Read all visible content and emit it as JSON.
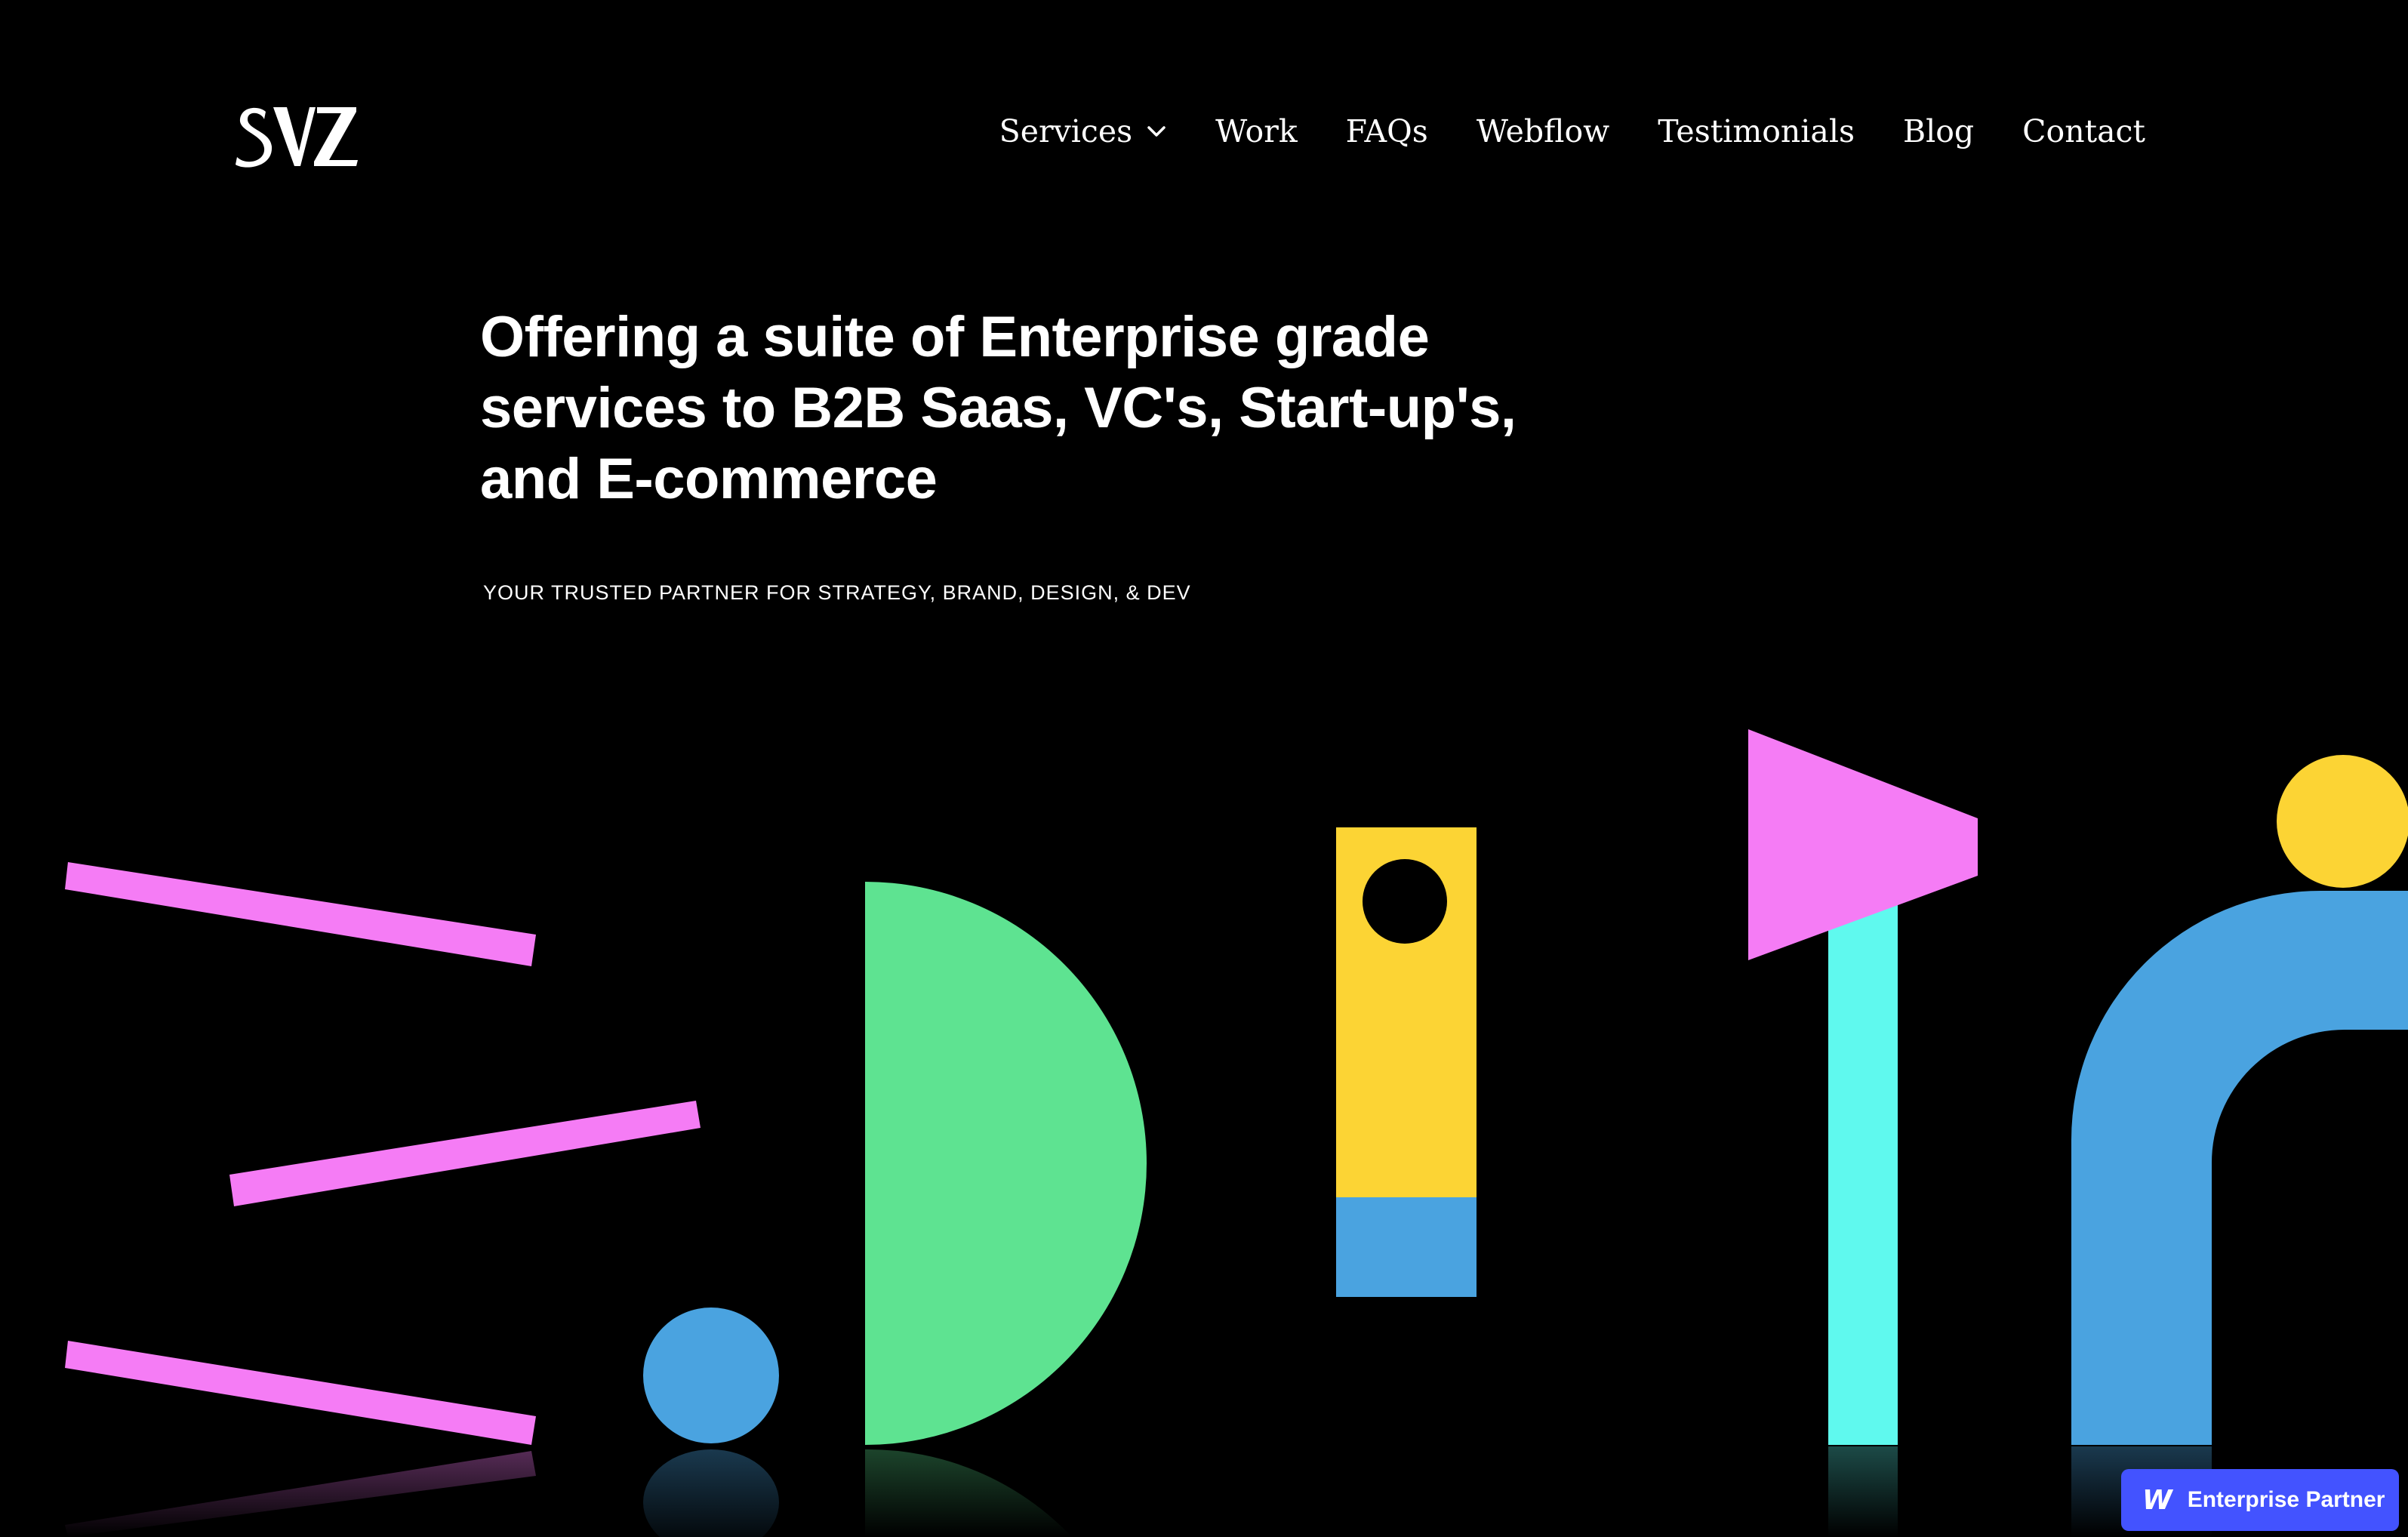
{
  "brand": {
    "logo_text": "SVZ"
  },
  "nav": {
    "items": [
      {
        "label": "Services",
        "has_dropdown": true,
        "icon": "chevron-down-icon"
      },
      {
        "label": "Work"
      },
      {
        "label": "FAQs"
      },
      {
        "label": "Webflow"
      },
      {
        "label": "Testimonials"
      },
      {
        "label": "Blog"
      },
      {
        "label": "Contact"
      }
    ]
  },
  "hero": {
    "title_lines": [
      "Offering a suite of Enterprise grade",
      "services to B2B Saas, VC's, Start-up's,",
      "and E-commerce"
    ],
    "subtitle": "YOUR TRUSTED PARTNER FOR STRATEGY, BRAND, DESIGN, & DEV"
  },
  "badge": {
    "icon": "webflow-w-icon",
    "icon_glyph": "W",
    "label": "Enterprise Partner"
  },
  "colors": {
    "background": "#000000",
    "pink": "#f57cf5",
    "green": "#5ee391",
    "yellow": "#fcd434",
    "blue": "#4aa3e0",
    "cyan": "#5ff9ee",
    "badge": "#4353ff"
  }
}
